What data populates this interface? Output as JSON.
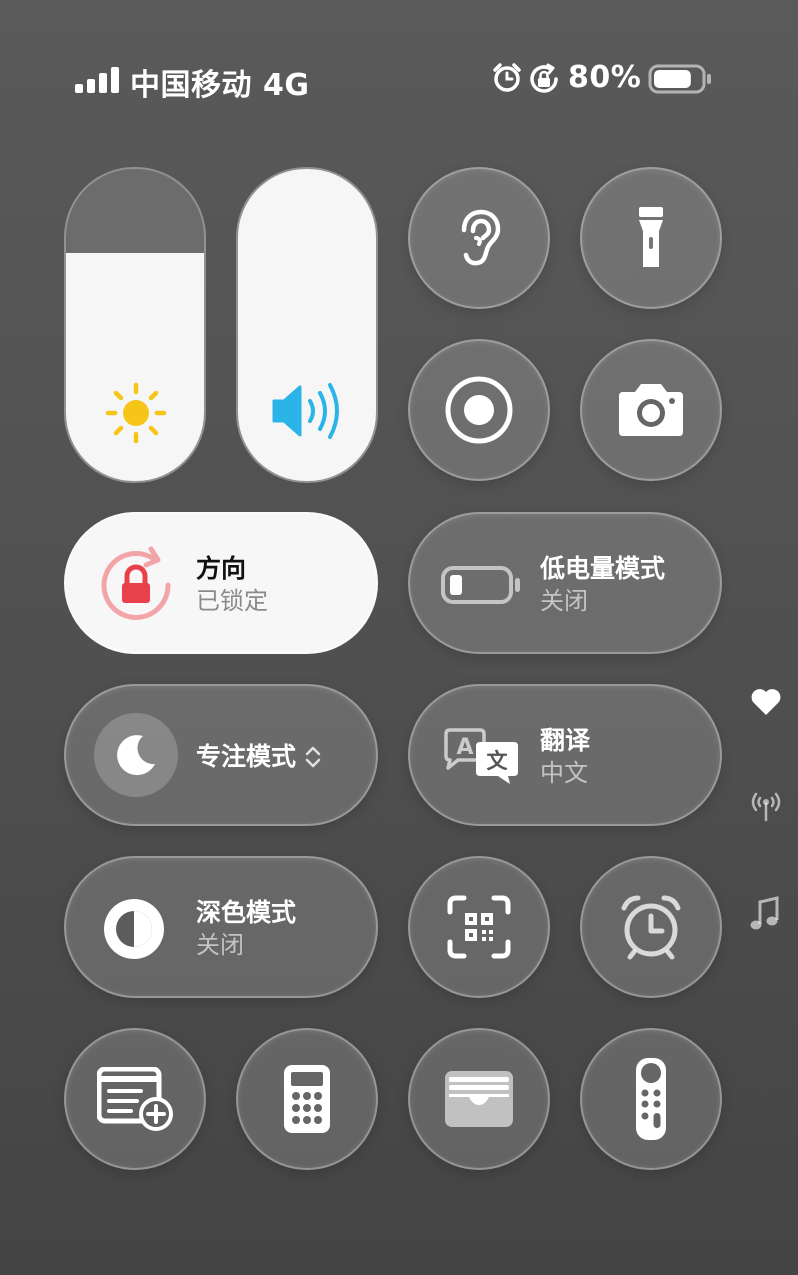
{
  "status_bar": {
    "carrier": "中国移动",
    "network": "4G",
    "battery_percent": "80%",
    "signal_bars": 4,
    "battery_level": 0.8
  },
  "sliders": {
    "brightness": {
      "icon": "sun-icon",
      "level": 0.73,
      "color": "#f5c518"
    },
    "volume": {
      "icon": "speaker-icon",
      "level": 1.0,
      "color": "#2bb4e8"
    }
  },
  "top_buttons": [
    {
      "icon": "ear-icon"
    },
    {
      "icon": "flashlight-icon"
    },
    {
      "icon": "screen-record-icon"
    },
    {
      "icon": "camera-icon"
    }
  ],
  "orientation": {
    "title": "方向",
    "subtitle": "已锁定",
    "icon": "orientation-lock-icon",
    "accent": "#e8414b"
  },
  "low_power": {
    "title": "低电量模式",
    "subtitle": "关闭",
    "icon": "battery-icon"
  },
  "focus": {
    "title": "专注模式",
    "icon": "moon-icon"
  },
  "translate": {
    "title": "翻译",
    "subtitle": "中文",
    "icon": "translate-icon"
  },
  "dark_mode": {
    "title": "深色模式",
    "subtitle": "关闭",
    "icon": "dark-mode-icon"
  },
  "row5_buttons": [
    {
      "icon": "qr-scan-icon"
    },
    {
      "icon": "alarm-clock-icon"
    }
  ],
  "bottom_buttons": [
    {
      "icon": "add-note-icon"
    },
    {
      "icon": "calculator-icon"
    },
    {
      "icon": "wallet-icon"
    },
    {
      "icon": "apple-tv-remote-icon"
    }
  ],
  "side_indicators": [
    {
      "icon": "heart-icon"
    },
    {
      "icon": "broadcast-icon"
    },
    {
      "icon": "music-note-icon"
    }
  ]
}
